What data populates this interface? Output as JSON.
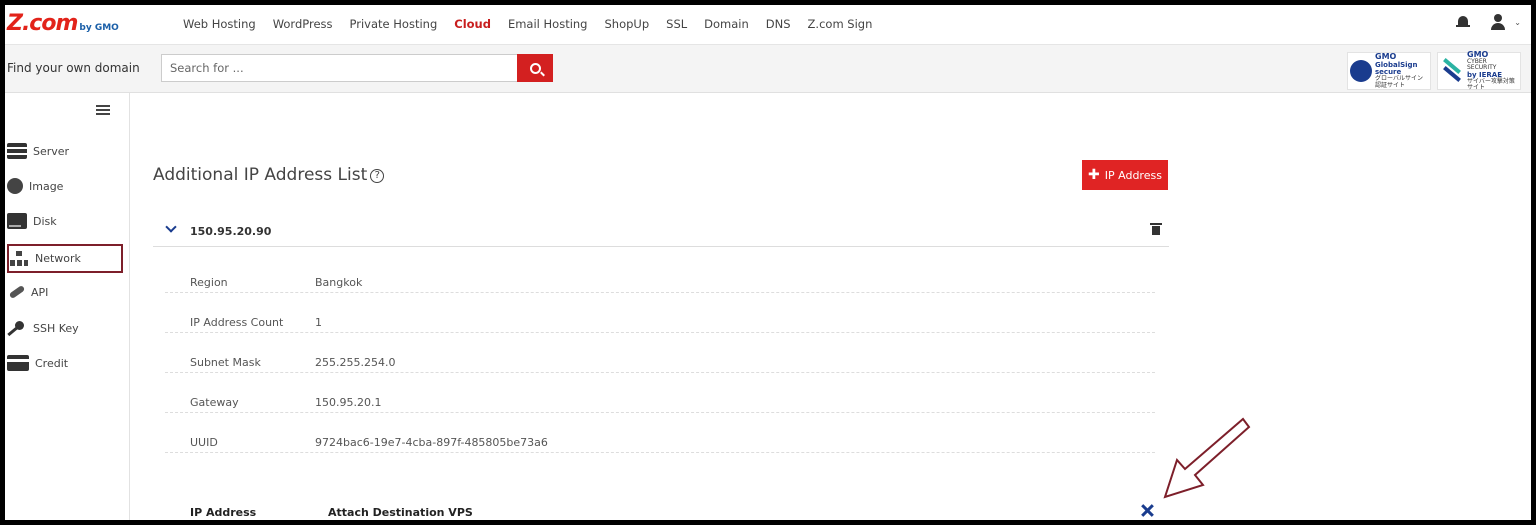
{
  "brand": {
    "logo_main": "Z.com",
    "logo_sub": "by GMO"
  },
  "nav": {
    "items": [
      "Web Hosting",
      "WordPress",
      "Private Hosting",
      "Cloud",
      "Email Hosting",
      "ShopUp",
      "SSL",
      "Domain",
      "DNS",
      "Z.com Sign"
    ],
    "active": "Cloud"
  },
  "search": {
    "label": "Find your own domain",
    "placeholder": "Search for ..."
  },
  "badges": {
    "globalsign": {
      "l1": "GMO",
      "l2": "GlobalSign",
      "l3": "secure",
      "l4": "グローバルサイン認証サイト"
    },
    "ierae": {
      "l1": "GMO",
      "l2": "CYBER SECURITY",
      "l3": "by IERAE",
      "l4": "サイバー攻撃対策サイト"
    }
  },
  "sidebar": {
    "items": [
      {
        "label": "Server",
        "icon": "server-icon"
      },
      {
        "label": "Image",
        "icon": "image-icon"
      },
      {
        "label": "Disk",
        "icon": "disk-icon"
      },
      {
        "label": "Network",
        "icon": "network-icon",
        "highlighted": true
      },
      {
        "label": "API",
        "icon": "api-icon"
      },
      {
        "label": "SSH Key",
        "icon": "key-icon"
      },
      {
        "label": "Credit",
        "icon": "credit-card-icon"
      }
    ]
  },
  "main": {
    "title": "Additional IP Address List",
    "add_button": "IP Address",
    "ip_block": {
      "address": "150.95.20.90",
      "details": [
        {
          "label": "Region",
          "value": "Bangkok"
        },
        {
          "label": "IP Address Count",
          "value": "1"
        },
        {
          "label": "Subnet Mask",
          "value": "255.255.254.0"
        },
        {
          "label": "Gateway",
          "value": "150.95.20.1"
        },
        {
          "label": "UUID",
          "value": "9724bac6-19e7-4cba-897f-485805be73a6"
        }
      ],
      "table_headers": [
        "IP Address",
        "Attach Destination VPS"
      ]
    }
  },
  "colors": {
    "accent": "#e02424",
    "brand_red": "#c81e1e",
    "highlight_border": "#7d1f2a",
    "icon_blue": "#1a3c8e"
  }
}
